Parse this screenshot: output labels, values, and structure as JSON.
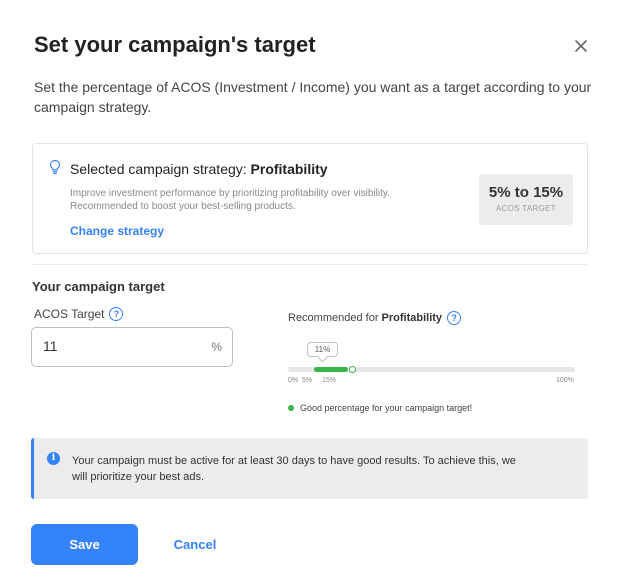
{
  "modal": {
    "title": "Set your campaign's target",
    "description": "Set the percentage of ACOS (Investment / Income) you want as a target according to your campaign strategy."
  },
  "strategy": {
    "title_prefix": "Selected campaign strategy: ",
    "title_value": "Profitability",
    "description": "Improve investment performance by prioritizing profitability over visibility. Recommended to boost your best-selling products.",
    "change_link": "Change strategy",
    "target_range": "5% to 15%",
    "target_caption": "ACOS TARGET"
  },
  "campaign_target": {
    "section_title": "Your campaign target",
    "acos_label": "ACOS Target",
    "help_glyph": "?",
    "acos_value": "11",
    "percent_suffix": "%"
  },
  "recommendation": {
    "label_prefix": "Recommended for ",
    "label_value": "Profitability",
    "bubble": "11%",
    "current": 11,
    "range_min": 5,
    "range_max": 15,
    "scale_max": 100,
    "ticks": [
      "0%",
      "5%",
      "15%",
      "100%"
    ],
    "message": "Good percentage for your campaign target!"
  },
  "info": {
    "icon_glyph": "i",
    "text": "Your campaign must be active for at least 30 days to have good results. To achieve this, we will prioritize your best ads."
  },
  "actions": {
    "save_label": "Save",
    "cancel_label": "Cancel"
  },
  "colors": {
    "accent": "#3483fa",
    "success": "#39b54a"
  },
  "icons": {
    "close": "close-icon",
    "bulb": "lightbulb-icon",
    "help": "help-circle-icon",
    "info": "info-icon"
  }
}
